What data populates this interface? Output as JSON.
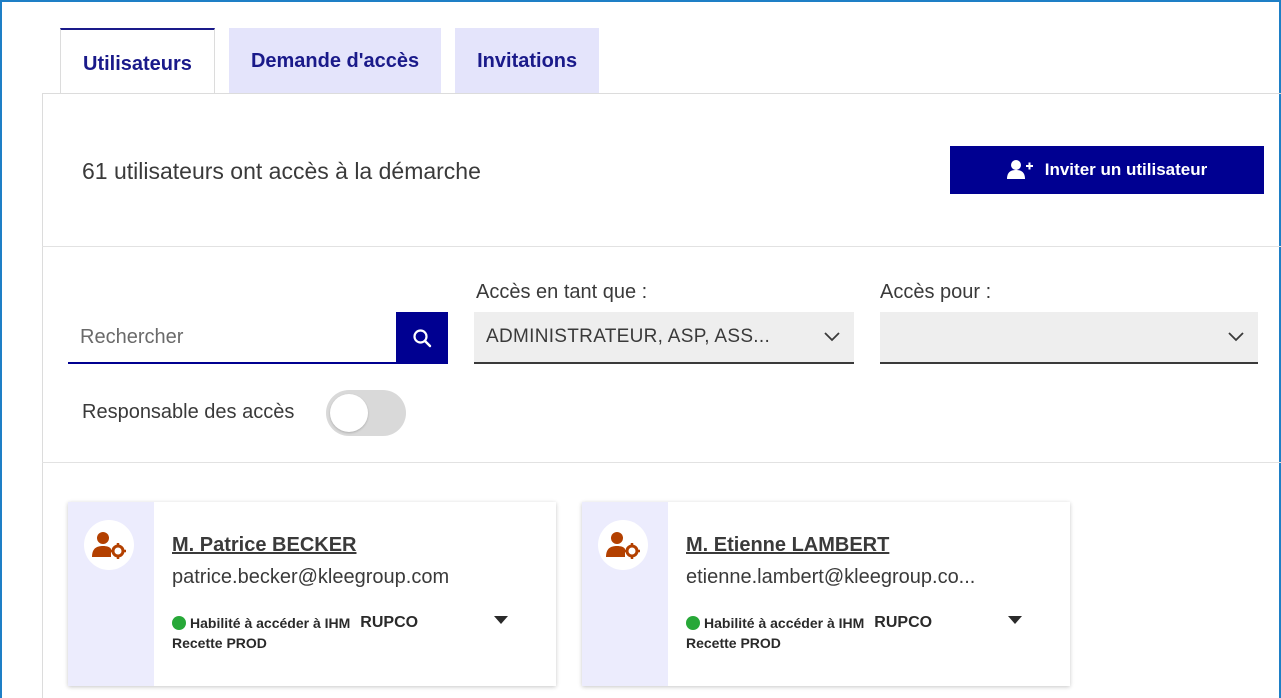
{
  "tabs": [
    {
      "label": "Utilisateurs",
      "active": true
    },
    {
      "label": "Demande d'accès",
      "active": false
    },
    {
      "label": "Invitations",
      "active": false
    }
  ],
  "summary": {
    "count_text": "61 utilisateurs ont accès à la démarche"
  },
  "actions": {
    "invite_label": "Inviter un utilisateur"
  },
  "filters": {
    "search_placeholder": "Rechercher",
    "role_label": "Accès en tant que :",
    "role_value": "ADMINISTRATEUR, ASP, ASS...",
    "scope_label": "Accès pour :",
    "scope_value": "",
    "toggle_label": "Responsable des accès",
    "toggle_on": false
  },
  "users": [
    {
      "name": "M. Patrice BECKER",
      "email": "patrice.becker@kleegroup.com",
      "habilitation": "Habilité à accéder à IHM",
      "app": "RUPCO",
      "environment": "Recette PROD"
    },
    {
      "name": "M. Etienne LAMBERT",
      "email": "etienne.lambert@kleegroup.co...",
      "habilitation": "Habilité à accéder à IHM",
      "app": "RUPCO",
      "environment": "Recette PROD"
    }
  ],
  "colors": {
    "primary": "#000091",
    "tab_bg": "#e4e4fb",
    "card_side": "#ececfd",
    "status_ok": "#27a838",
    "avatar_icon": "#b34000"
  }
}
